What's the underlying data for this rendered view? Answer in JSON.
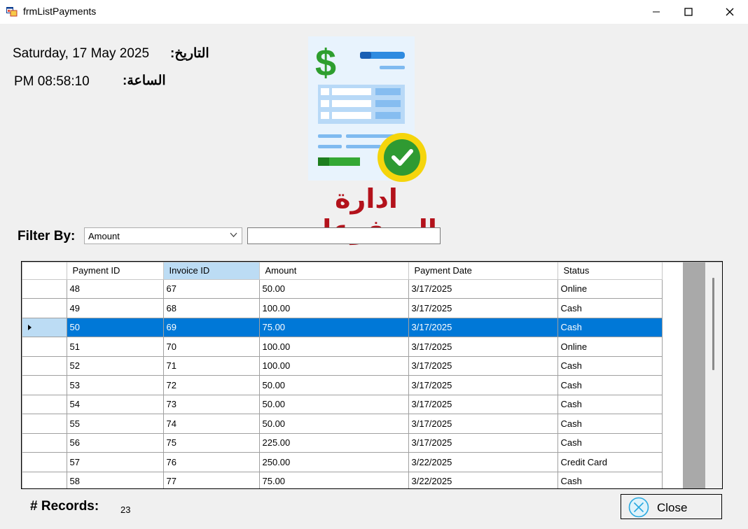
{
  "window": {
    "title": "frmListPayments"
  },
  "header": {
    "date_label": "التاريخ:",
    "date_value": "Saturday, 17 May 2025",
    "time_label": "الساعة:",
    "time_value": "PM 08:58:10",
    "page_title": "ادارة المدفوعات"
  },
  "filter": {
    "label": "Filter By:",
    "selected": "Amount",
    "text_value": ""
  },
  "grid": {
    "columns": [
      "Payment ID",
      "Invoice ID",
      "Amount",
      "Payment Date",
      "Status"
    ],
    "selected_row_index": 2,
    "rows": [
      [
        "48",
        "67",
        "50.00",
        "3/17/2025",
        "Online"
      ],
      [
        "49",
        "68",
        "100.00",
        "3/17/2025",
        "Cash"
      ],
      [
        "50",
        "69",
        "75.00",
        "3/17/2025",
        "Cash"
      ],
      [
        "51",
        "70",
        "100.00",
        "3/17/2025",
        "Online"
      ],
      [
        "52",
        "71",
        "100.00",
        "3/17/2025",
        "Cash"
      ],
      [
        "53",
        "72",
        "50.00",
        "3/17/2025",
        "Cash"
      ],
      [
        "54",
        "73",
        "50.00",
        "3/17/2025",
        "Cash"
      ],
      [
        "55",
        "74",
        "50.00",
        "3/17/2025",
        "Cash"
      ],
      [
        "56",
        "75",
        "225.00",
        "3/17/2025",
        "Cash"
      ],
      [
        "57",
        "76",
        "250.00",
        "3/22/2025",
        "Credit Card"
      ],
      [
        "58",
        "77",
        "75.00",
        "3/22/2025",
        "Cash"
      ]
    ]
  },
  "footer": {
    "records_label": "# Records:",
    "records_count": "23",
    "close_label": "Close"
  },
  "icons": {
    "app": "app-form-icon",
    "minimize": "minimize-icon",
    "maximize": "maximize-icon",
    "close": "close-x-icon",
    "invoice": "invoice-paid-icon",
    "close_button": "close-circle-icon"
  },
  "colors": {
    "title": "#b3121b",
    "selection": "#0078d7",
    "header_selected": "#bcdcf4"
  }
}
